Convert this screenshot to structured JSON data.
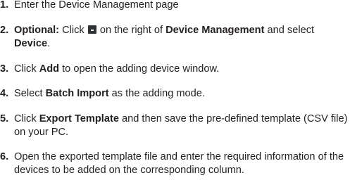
{
  "steps": [
    {
      "num": "1.",
      "text": "Enter the Device Management page"
    },
    {
      "num": "2.",
      "label": "Optional:",
      "t1": " Click ",
      "t2": " on the right of ",
      "b1": "Device Management",
      "t3": " and select ",
      "b2": "Device",
      "t4": ".",
      "icon": "menu-icon"
    },
    {
      "num": "3.",
      "t1": "Click ",
      "b1": "Add",
      "t2": " to open the adding device window."
    },
    {
      "num": "4.",
      "t1": "Select ",
      "b1": "Batch Import",
      "t2": " as the adding mode."
    },
    {
      "num": "5.",
      "t1": "Click ",
      "b1": "Export Template",
      "t2": " and then save the pre-defined template (CSV file) on your PC."
    },
    {
      "num": "6.",
      "text": "Open the exported template file and enter the required information of the devices to be added on the corresponding column."
    }
  ]
}
